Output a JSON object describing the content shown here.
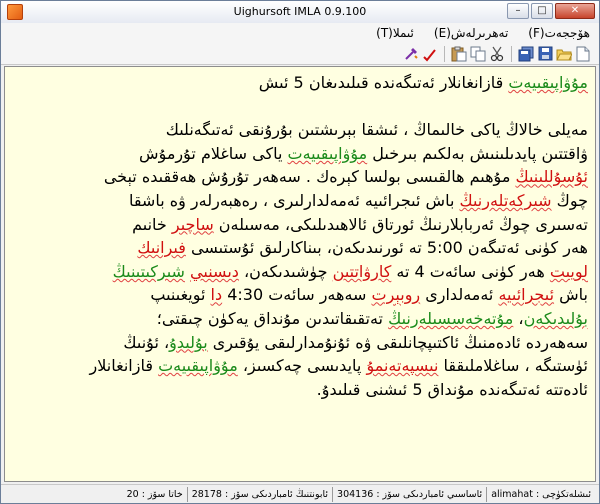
{
  "window": {
    "title": "Uighursoft IMLA 0.9.100",
    "minimize": "–",
    "maximize": "□",
    "close": "✕"
  },
  "menu": {
    "items": [
      {
        "label": "ھۆججەت(F)"
      },
      {
        "label": "تەھرىرلەش(E)"
      },
      {
        "label": "ئىملا(T)"
      }
    ]
  },
  "toolbar": {
    "icons": [
      "new-file-icon",
      "open-folder-icon",
      "save-icon",
      "save-all-icon",
      "cut-icon",
      "copy-icon",
      "paste-icon",
      "spellcheck-icon",
      "settings-icon"
    ]
  },
  "editor": {
    "lines": [
      [
        {
          "t": "مۇۋاپىقىيەت",
          "c": "green"
        },
        {
          "t": " قازانغانلار ئەتىگەندە قىلىدىغان 5 ئىش",
          "c": ""
        }
      ],
      [],
      [
        {
          "t": "مەيلى خالاڭ ياكى خالىماڭ ، ئىشقا بېرىشتىن بۇرۇنقى ئەتىگەنلىك",
          "c": ""
        }
      ],
      [
        {
          "t": "ۋاقتتىن پايدىلىنىش بەلكىم بىرخىل ",
          "c": ""
        },
        {
          "t": "مۇۋاپىقىيەت",
          "c": "green"
        },
        {
          "t": " ياكى ساغلام تۇرمۇش",
          "c": ""
        }
      ],
      [
        {
          "t": "ئۇسۇللىنىڭ",
          "c": "red"
        },
        {
          "t": " مۇھىم ھالقىسى بولسا كېرەك . سەھەر تۇرۇش ھەققىدە تېخى",
          "c": ""
        }
      ],
      [
        {
          "t": "چوڭ ",
          "c": ""
        },
        {
          "t": "شىركەتلەرنىڭ",
          "c": "red"
        },
        {
          "t": " باش ئىجرائىيە ئەمەلدارلىرى ، رەھبەرلەر ۋە باشقا",
          "c": ""
        }
      ],
      [
        {
          "t": "تەسىرى چوڭ ئەربابلارنىڭ ئورتاق ئالاھىدىلىكى، مەسىلەن ",
          "c": ""
        },
        {
          "t": "ساچىر",
          "c": "red"
        },
        {
          "t": " خانىم",
          "c": ""
        }
      ],
      [
        {
          "t": "ھەر كۈنى ئەتىگەن 5:00 تە ئورنىدىكەن، بىناكارلىق ئۇستىسى ",
          "c": ""
        },
        {
          "t": "فىرانىك",
          "c": "red"
        }
      ],
      [
        {
          "t": "لويىت",
          "c": "red"
        },
        {
          "t": " ھەر كۈنى سائەت 4 تە ",
          "c": ""
        },
        {
          "t": "كارۋاتتىن",
          "c": "red"
        },
        {
          "t": " چۈشىدىكەن، ",
          "c": ""
        },
        {
          "t": "دىسنىي",
          "c": "red"
        },
        {
          "t": " ",
          "c": ""
        },
        {
          "t": "شىركىتىنىڭ",
          "c": "green"
        }
      ],
      [
        {
          "t": "باش ",
          "c": ""
        },
        {
          "t": "ئىجرائىيە",
          "c": "red"
        },
        {
          "t": " ئەمەلدارى ",
          "c": ""
        },
        {
          "t": "روبېرت",
          "c": "red"
        },
        {
          "t": " سەھەر سائەت 4:30 ",
          "c": ""
        },
        {
          "t": "دا",
          "c": "red"
        },
        {
          "t": " ئويغىنىپ",
          "c": ""
        }
      ],
      [
        {
          "t": "بۇلىدىكەن",
          "c": "green"
        },
        {
          "t": "، ",
          "c": ""
        },
        {
          "t": "مۇتەخەسسىلەرنىڭ",
          "c": "green"
        },
        {
          "t": " تەتقىقاتىدىن مۇنداق يەكۈن چىقتى؛",
          "c": ""
        }
      ],
      [
        {
          "t": "سەھەردە ئادەمنىڭ ئاكتىپچانلىقى ۋە ئۇنۇمدارلىقى يۇقىرى ",
          "c": ""
        },
        {
          "t": "بۇلىدۇ",
          "c": "green"
        },
        {
          "t": "، ئۇنىڭ",
          "c": ""
        }
      ],
      [
        {
          "t": "ئۈستىگە ، ساغلاملىققا ",
          "c": ""
        },
        {
          "t": "نىسپەتەنمۇ",
          "c": "red"
        },
        {
          "t": " پايدىسى چەكسىز، ",
          "c": ""
        },
        {
          "t": "مۇۋاپىقىيەت",
          "c": "green"
        },
        {
          "t": " قازانغانلار",
          "c": ""
        }
      ],
      [
        {
          "t": "ئادەتتە ئەتىگەندە مۇنداق 5 ئىشنى قىلىدۇ.",
          "c": ""
        }
      ]
    ]
  },
  "status": {
    "user": "ئىشلەتكۈچى : alimahat",
    "total_words": "ئاساسىي ئامباردىكى سۆز : 304136",
    "user_words": "ئابونتنىڭ ئامباردىكى سۆز : 28178",
    "wrong_words": "خاتا سۆز : 20"
  },
  "colors": {
    "editor_bg": "#ffffe1",
    "misspelled_red": "#d01010",
    "suggestion_green": "#1a8a1a"
  }
}
